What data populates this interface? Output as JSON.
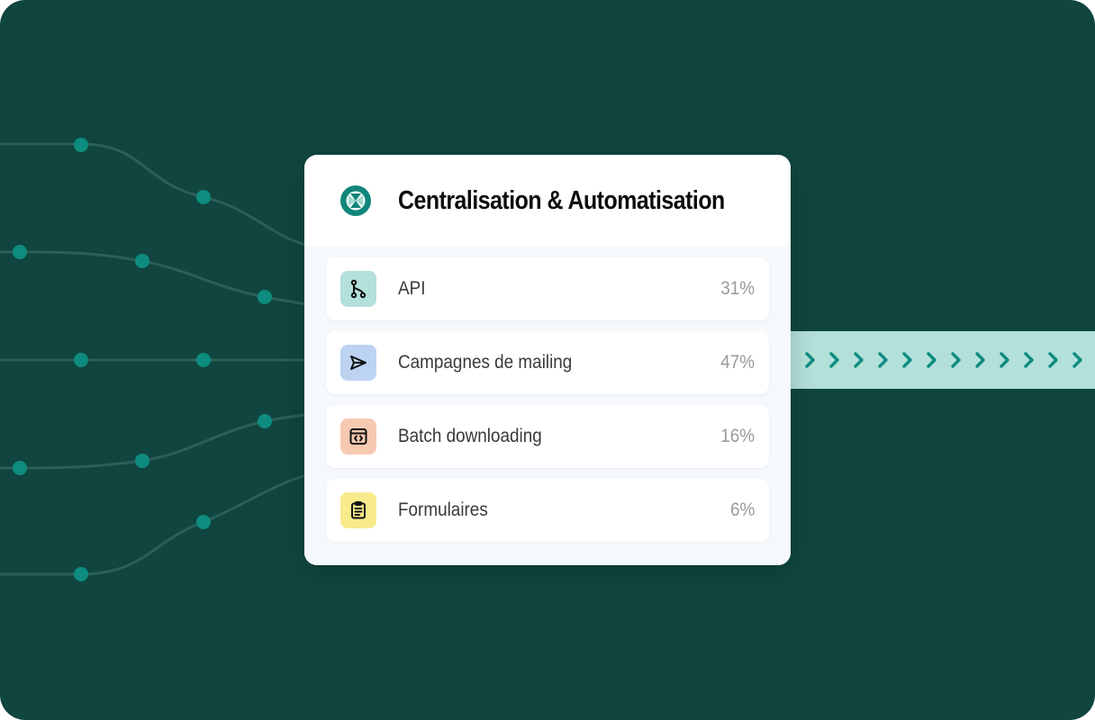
{
  "card": {
    "title": "Centralisation & Automatisation",
    "logo_icon": "brand-logo-icon",
    "items": [
      {
        "label": "API",
        "percent": "31%",
        "icon": "git-branch-icon",
        "icon_bg": "#b3e0da"
      },
      {
        "label": "Campagnes de mailing",
        "percent": "47%",
        "icon": "send-icon",
        "icon_bg": "#bcd3f2"
      },
      {
        "label": "Batch downloading",
        "percent": "16%",
        "icon": "code-window-icon",
        "icon_bg": "#f6c9b1"
      },
      {
        "label": "Formulaires",
        "percent": "6%",
        "icon": "clipboard-icon",
        "icon_bg": "#f8eb8c"
      }
    ]
  },
  "colors": {
    "background": "#10463f",
    "accent": "#0e8c7f",
    "line": "#2b6059",
    "flow_band": "#b3e0da"
  }
}
